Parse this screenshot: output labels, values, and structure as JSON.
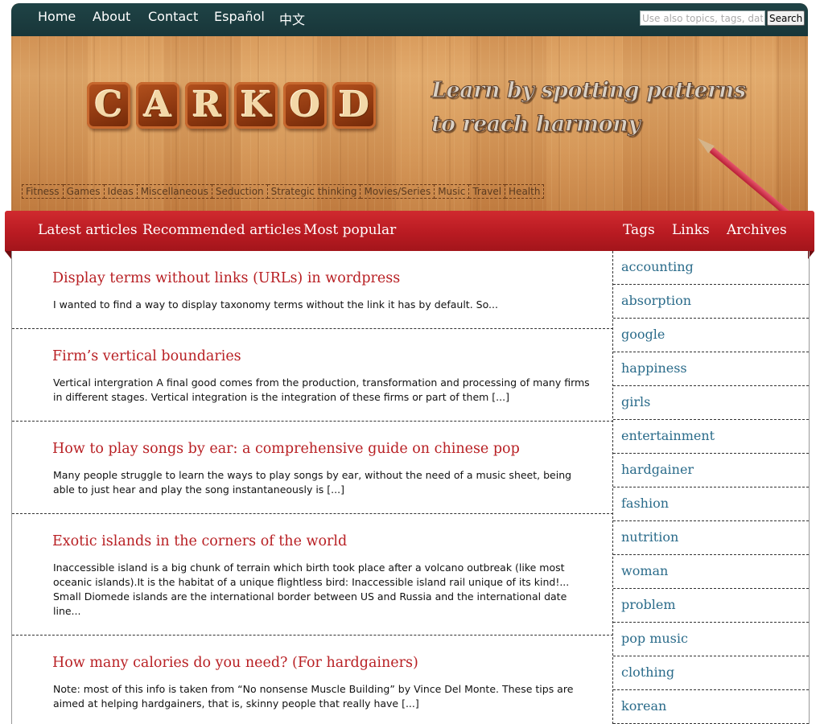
{
  "top_nav": {
    "items": [
      "Home",
      "About",
      "Contact",
      "Español",
      "中文"
    ]
  },
  "search": {
    "placeholder": "Use also topics, tags, dates",
    "button_label": "Search"
  },
  "logo": {
    "letters": [
      "C",
      "A",
      "R",
      "K",
      "O",
      "D"
    ]
  },
  "tagline": {
    "line1": "Learn by spotting patterns",
    "line2": "to reach harmony"
  },
  "categories": [
    "Fitness",
    "Games",
    "Ideas",
    "Miscellaneous",
    "Seduction",
    "Strategic thinking",
    "Movies/Series",
    "Music",
    "Travel",
    "Health"
  ],
  "main_nav": {
    "left": [
      "Latest articles",
      "Recommended articles",
      "Most popular"
    ],
    "right": [
      "Tags",
      "Links",
      "Archives"
    ]
  },
  "articles": [
    {
      "title": "Display terms without links (URLs) in wordpress",
      "excerpt": "I wanted to find a way to display taxonomy terms without the link it has by default. So..."
    },
    {
      "title": "Firm’s vertical boundaries",
      "excerpt": "Vertical intergration A final good comes from the production, transformation and processing of many firms in different stages. Vertical integration is the integration of these firms or part of them [...]"
    },
    {
      "title": "How to play songs by ear: a comprehensive guide on chinese pop",
      "excerpt": "Many people struggle to learn the ways to play songs by ear, without the need of a music sheet, being able to just hear and play the song instantaneously is [...]"
    },
    {
      "title": "Exotic islands in the corners of the world",
      "excerpt": "Inaccessible island is a big chunk of terrain which birth took place after a volcano outbreak (like most oceanic islands).It is the habitat of a unique flightless bird: Inaccessible island rail unique of its kind!... Small Diomede islands are the international border between US and Russia and the international date line..."
    },
    {
      "title": "How many calories do you need? (For hardgainers)",
      "excerpt": "Note: most of this info is taken from “No nonsense Muscle Building” by Vince Del Monte. These tips are aimed at helping hardgainers, that is, skinny people that really have [...]"
    }
  ],
  "sidebar_tags": [
    "accounting",
    "absorption",
    "google",
    "happiness",
    "girls",
    "entertainment",
    "hardgainer",
    "fashion",
    "nutrition",
    "woman",
    "problem",
    "pop music",
    "clothing",
    "korean"
  ]
}
